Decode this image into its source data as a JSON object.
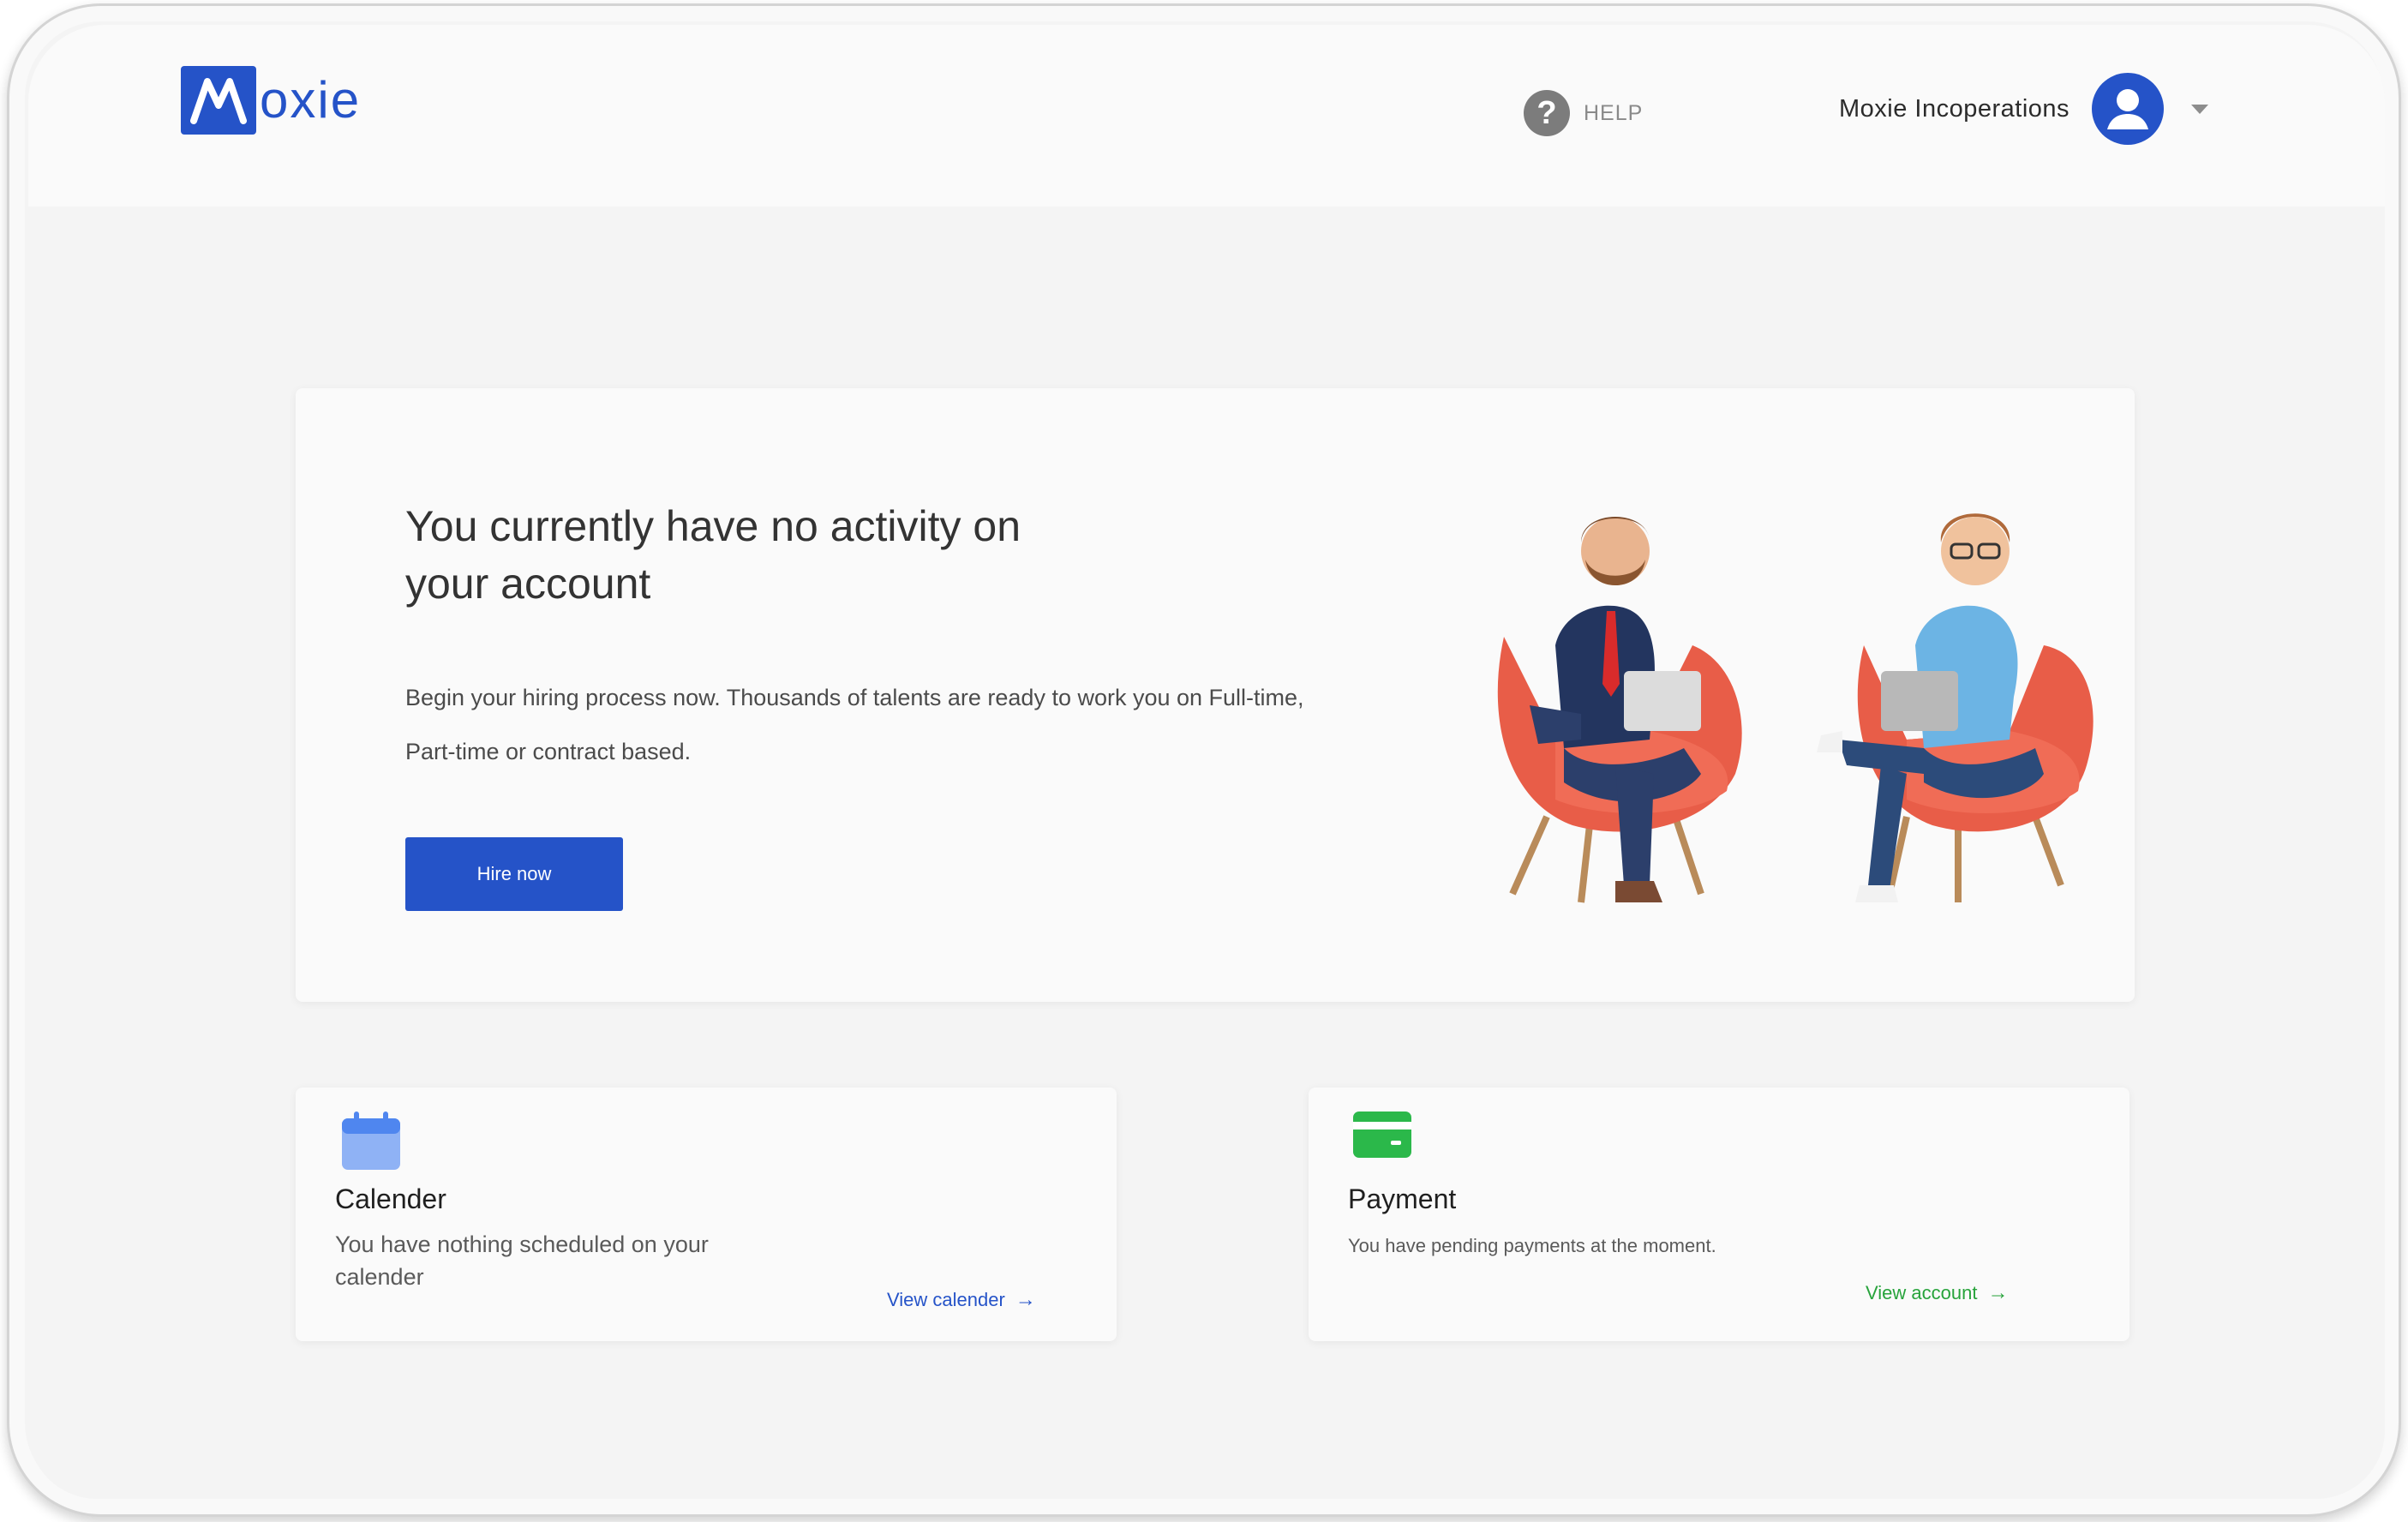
{
  "app": {
    "logo_text": "oxie",
    "logo_mark": "M"
  },
  "header": {
    "help_label": "HELP",
    "account_name": "Moxie Incoperations"
  },
  "hero": {
    "title": "You currently have no activity on your account",
    "description": "Begin your hiring process now. Thousands of talents are ready to work you on Full-time, Part-time or contract based.",
    "cta_label": "Hire now"
  },
  "calendar_card": {
    "title": "Calender",
    "text": "You have nothing scheduled on your calender",
    "link_label": "View calender",
    "icon": "calendar-icon"
  },
  "payment_card": {
    "title": "Payment",
    "text": "You have pending payments at the moment.",
    "link_label": "View account",
    "icon": "payment-card-icon"
  },
  "colors": {
    "brand": "#2553c8",
    "success": "#27a33b",
    "background": "#f4f4f4",
    "card": "#fafafa"
  }
}
